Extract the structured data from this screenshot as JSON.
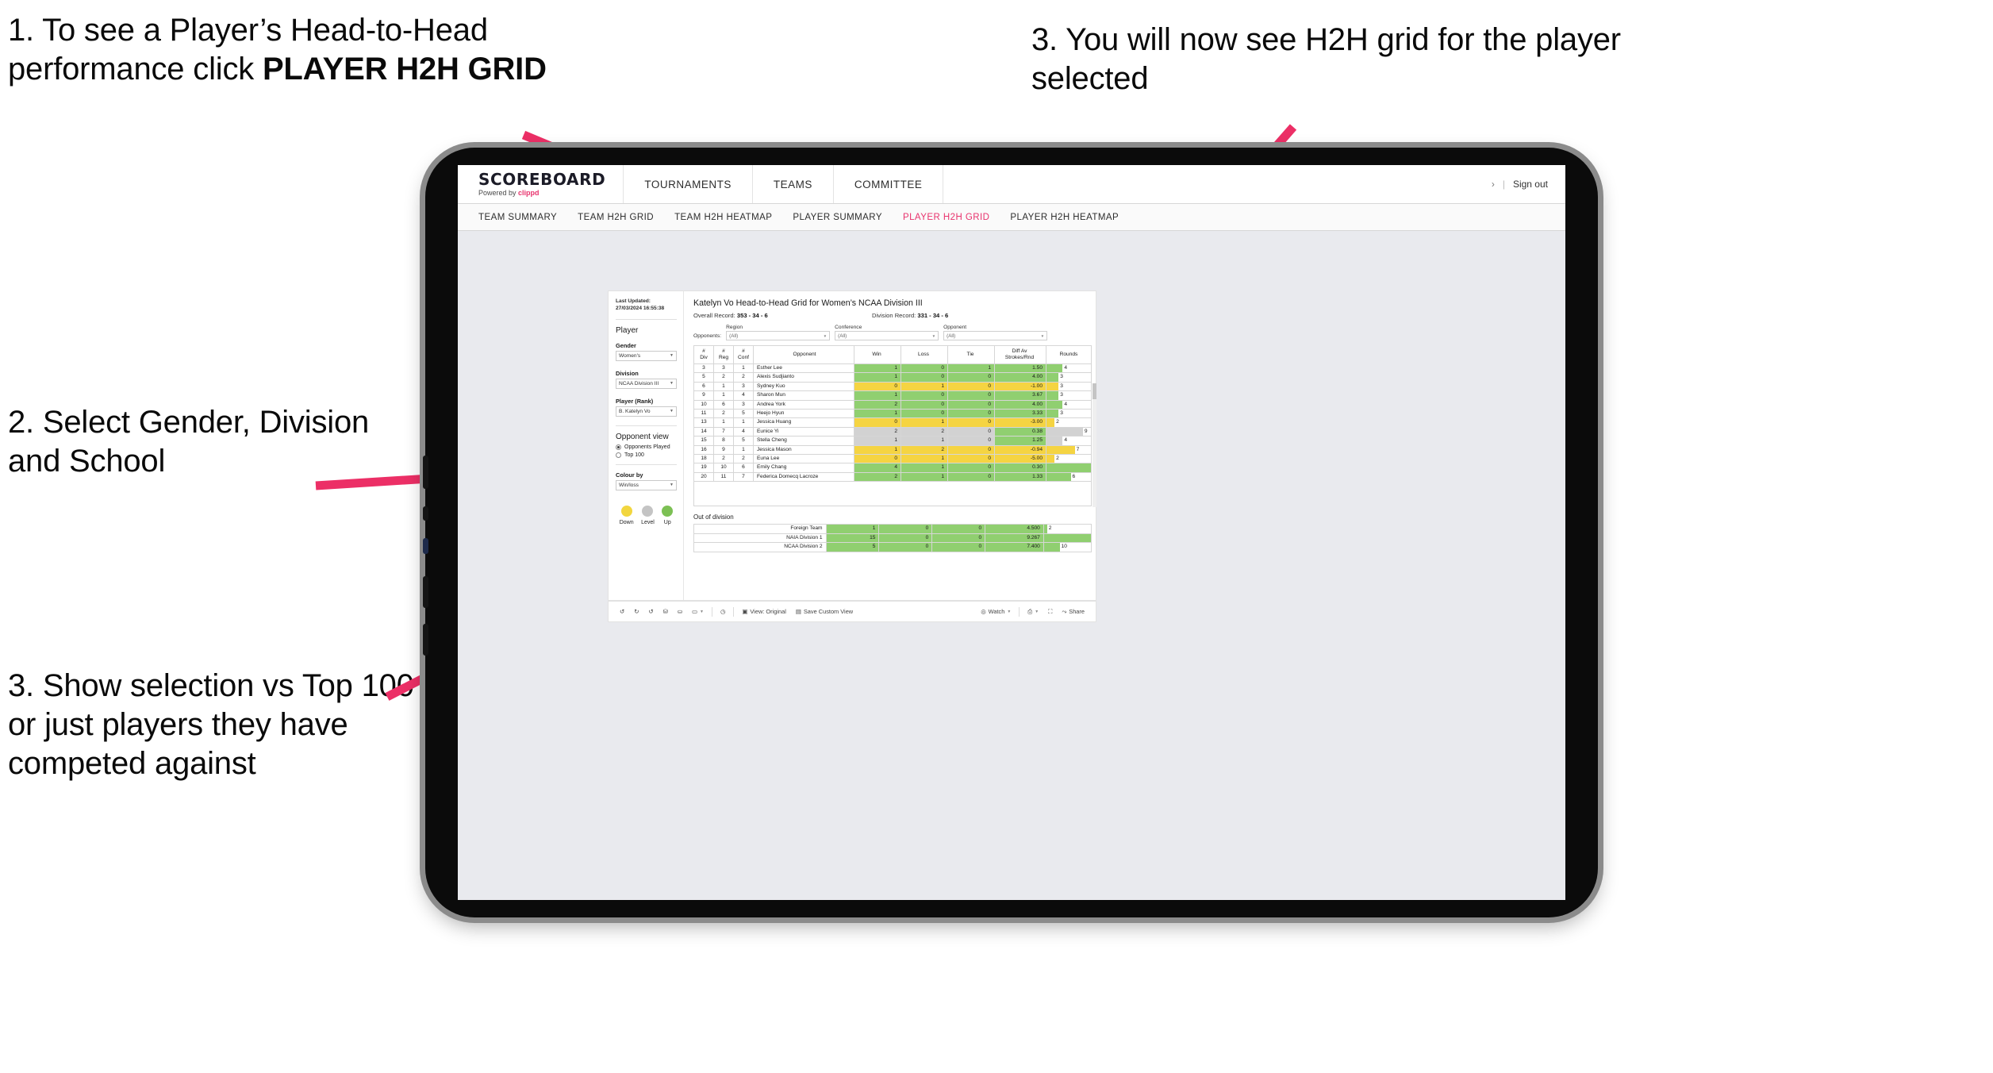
{
  "annotations": {
    "one_a": "1. To see a Player’s Head-to-Head performance click ",
    "one_b": "PLAYER H2H GRID",
    "two": "2. Select Gender, Division and School",
    "three": "3. Show selection vs Top 100 or just players they have competed against",
    "four": "3. You will now see H2H grid for the player selected",
    "arrow_color": "#ec2f66"
  },
  "app": {
    "brand": {
      "name": "SCOREBOARD",
      "powered_prefix": "Powered by ",
      "powered_brand": "clippd"
    },
    "nav": [
      "TOURNAMENTS",
      "TEAMS",
      "COMMITTEE"
    ],
    "sign_out": "Sign out",
    "sign_out_chevron": "›",
    "sign_out_divider": "|",
    "tabs": [
      {
        "label": "TEAM SUMMARY",
        "active": false
      },
      {
        "label": "TEAM H2H GRID",
        "active": false
      },
      {
        "label": "TEAM H2H HEATMAP",
        "active": false
      },
      {
        "label": "PLAYER SUMMARY",
        "active": false
      },
      {
        "label": "PLAYER H2H GRID",
        "active": true
      },
      {
        "label": "PLAYER H2H HEATMAP",
        "active": false
      }
    ],
    "active_tab_color": "#e8336d"
  },
  "sidebar": {
    "last_updated": "Last Updated: 27/03/2024 16:55:38",
    "player_heading": "Player",
    "gender": {
      "label": "Gender",
      "value": "Women's"
    },
    "division": {
      "label": "Division",
      "value": "NCAA Division III"
    },
    "player_rank": {
      "label": "Player (Rank)",
      "value": "B. Katelyn Vo"
    },
    "opponent_view": {
      "heading": "Opponent view",
      "options": [
        {
          "label": "Opponents Played",
          "selected": true
        },
        {
          "label": "Top 100",
          "selected": false
        }
      ]
    },
    "colour_by": {
      "label": "Colour by",
      "value": "Win/loss"
    },
    "legend": [
      {
        "label": "Down",
        "color": "#f2d63f"
      },
      {
        "label": "Level",
        "color": "#c4c4c4"
      },
      {
        "label": "Up",
        "color": "#7cc054"
      }
    ]
  },
  "viz": {
    "title": "Katelyn Vo Head-to-Head Grid for Women’s NCAA Division III",
    "overall_record_label": "Overall Record: ",
    "overall_record_value": "353 - 34 - 6",
    "division_record_label": "Division Record: ",
    "division_record_value": "331 - 34 - 6",
    "opponents_label": "Opponents:",
    "opponent_filters": [
      {
        "label": "Region",
        "value": "(All)"
      },
      {
        "label": "Conference",
        "value": "(All)"
      },
      {
        "label": "Opponent",
        "value": "(All)"
      }
    ],
    "out_of_division_title": "Out of division"
  },
  "chart_data": {
    "type": "table",
    "title": "Katelyn Vo Head-to-Head Grid for Women’s NCAA Division III",
    "columns": [
      "# Div",
      "# Reg",
      "# Conf",
      "Opponent",
      "Win",
      "Loss",
      "Tie",
      "Diff Av Strokes/Rnd",
      "Rounds"
    ],
    "column_headers_wrapped": [
      [
        "#",
        "Div"
      ],
      [
        "#",
        "Reg"
      ],
      [
        "#",
        "Conf"
      ],
      [
        "Opponent"
      ],
      [
        "Win"
      ],
      [
        "Loss"
      ],
      [
        "Tie"
      ],
      [
        "Diff Av",
        "Strokes/Rnd"
      ],
      [
        "Rounds"
      ]
    ],
    "rounds_max": 11,
    "rows": [
      {
        "div": "3",
        "reg": "3",
        "conf": "1",
        "opponent": "Esther Lee",
        "win": "1",
        "loss": "0",
        "tie": "1",
        "diff": "1.50",
        "rounds": "4",
        "rounds_n": 4,
        "state": "up"
      },
      {
        "div": "5",
        "reg": "2",
        "conf": "2",
        "opponent": "Alexis Sudjianto",
        "win": "1",
        "loss": "0",
        "tie": "0",
        "diff": "4.00",
        "rounds": "3",
        "rounds_n": 3,
        "state": "up"
      },
      {
        "div": "6",
        "reg": "1",
        "conf": "3",
        "opponent": "Sydney Kuo",
        "win": "0",
        "loss": "1",
        "tie": "0",
        "diff": "-1.00",
        "rounds": "3",
        "rounds_n": 3,
        "state": "down"
      },
      {
        "div": "9",
        "reg": "1",
        "conf": "4",
        "opponent": "Sharon Mun",
        "win": "1",
        "loss": "0",
        "tie": "0",
        "diff": "3.67",
        "rounds": "3",
        "rounds_n": 3,
        "state": "up"
      },
      {
        "div": "10",
        "reg": "6",
        "conf": "3",
        "opponent": "Andrea York",
        "win": "2",
        "loss": "0",
        "tie": "0",
        "diff": "4.00",
        "rounds": "4",
        "rounds_n": 4,
        "state": "up"
      },
      {
        "div": "11",
        "reg": "2",
        "conf": "5",
        "opponent": "Heejo Hyun",
        "win": "1",
        "loss": "0",
        "tie": "0",
        "diff": "3.33",
        "rounds": "3",
        "rounds_n": 3,
        "state": "up"
      },
      {
        "div": "13",
        "reg": "1",
        "conf": "1",
        "opponent": "Jessica Huang",
        "win": "0",
        "loss": "1",
        "tie": "0",
        "diff": "-3.00",
        "rounds": "2",
        "rounds_n": 2,
        "state": "down"
      },
      {
        "div": "14",
        "reg": "7",
        "conf": "4",
        "opponent": "Eunice Yi",
        "win": "2",
        "loss": "2",
        "tie": "0",
        "diff": "0.38",
        "rounds": "9",
        "rounds_n": 9,
        "state": "level",
        "diff_state": "up"
      },
      {
        "div": "15",
        "reg": "8",
        "conf": "5",
        "opponent": "Stella Cheng",
        "win": "1",
        "loss": "1",
        "tie": "0",
        "diff": "1.25",
        "rounds": "4",
        "rounds_n": 4,
        "state": "level",
        "diff_state": "up"
      },
      {
        "div": "16",
        "reg": "9",
        "conf": "1",
        "opponent": "Jessica Mason",
        "win": "1",
        "loss": "2",
        "tie": "0",
        "diff": "-0.94",
        "rounds": "7",
        "rounds_n": 7,
        "state": "down"
      },
      {
        "div": "18",
        "reg": "2",
        "conf": "2",
        "opponent": "Euna Lee",
        "win": "0",
        "loss": "1",
        "tie": "0",
        "diff": "-5.00",
        "rounds": "2",
        "rounds_n": 2,
        "state": "down"
      },
      {
        "div": "19",
        "reg": "10",
        "conf": "6",
        "opponent": "Emily Chang",
        "win": "4",
        "loss": "1",
        "tie": "0",
        "diff": "0.30",
        "rounds": "11",
        "rounds_n": 11,
        "state": "up"
      },
      {
        "div": "20",
        "reg": "11",
        "conf": "7",
        "opponent": "Federica Domecq Lacroze",
        "win": "2",
        "loss": "1",
        "tie": "0",
        "diff": "1.33",
        "rounds": "6",
        "rounds_n": 6,
        "state": "up"
      }
    ],
    "out_of_division": {
      "rounds_max": 30,
      "rows": [
        {
          "label": "Foreign Team",
          "win": "1",
          "loss": "0",
          "tie": "0",
          "diff": "4.500",
          "rounds": "2",
          "rounds_n": 2,
          "state": "up"
        },
        {
          "label": "NAIA Division 1",
          "win": "15",
          "loss": "0",
          "tie": "0",
          "diff": "9.267",
          "rounds": "30",
          "rounds_n": 30,
          "state": "up"
        },
        {
          "label": "NCAA Division 2",
          "win": "5",
          "loss": "0",
          "tie": "0",
          "diff": "7.400",
          "rounds": "10",
          "rounds_n": 10,
          "state": "up"
        }
      ]
    },
    "colors": {
      "up": "#90cf70",
      "down": "#f5d442",
      "level": "#d2d2d2"
    }
  },
  "toolbar": {
    "view_original": "View: Original",
    "save_custom_view": "Save Custom View",
    "watch": "Watch",
    "share": "Share"
  }
}
